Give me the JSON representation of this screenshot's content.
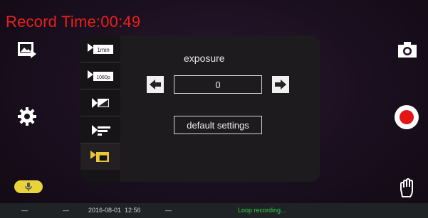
{
  "header": {
    "record_time": "Record Time:00:49"
  },
  "menu": {
    "items": [
      {
        "name": "menu-item-1min",
        "icon": "video-1min-icon"
      },
      {
        "name": "menu-item-1080p",
        "icon": "video-1080p-icon"
      },
      {
        "name": "menu-item-exposure",
        "icon": "exposure-icon"
      },
      {
        "name": "menu-item-sensitivity",
        "icon": "sensitivity-icon"
      },
      {
        "name": "menu-item-settings",
        "icon": "video-settings-icon"
      }
    ]
  },
  "exposure": {
    "label": "exposure",
    "value": "0",
    "default_label": "default settings"
  },
  "statusbar": {
    "dash1": "—",
    "dash2": "—",
    "datetime": "2016-08-01  12:56",
    "dash3": "—",
    "status": "Loop recording..."
  },
  "colors": {
    "record_red": "#e8201c",
    "status_green": "#2fd34a",
    "mic_yellow": "#e9d33a"
  }
}
